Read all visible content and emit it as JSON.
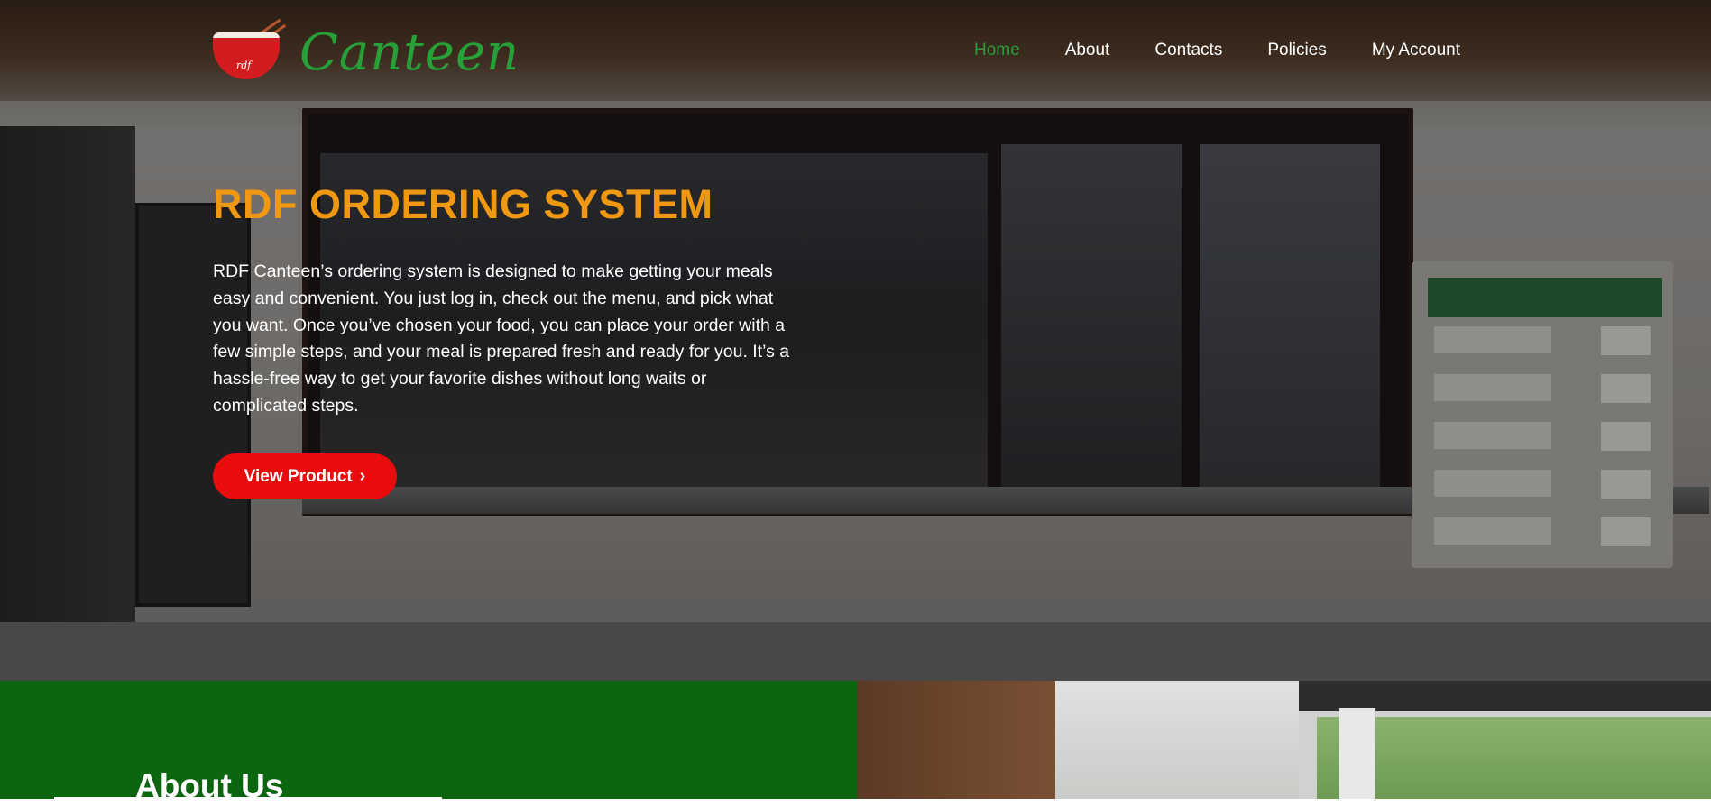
{
  "brand": {
    "name": "Canteen",
    "mark": "rdf"
  },
  "nav": {
    "items": [
      {
        "label": "Home",
        "active": true
      },
      {
        "label": "About",
        "active": false
      },
      {
        "label": "Contacts",
        "active": false
      },
      {
        "label": "Policies",
        "active": false
      },
      {
        "label": "My Account",
        "active": false
      }
    ]
  },
  "hero": {
    "title": "RDF ORDERING SYSTEM",
    "description": "RDF Canteen’s ordering system is designed to make getting your meals easy and convenient. You just log in, check out the menu, and pick what you want. Once you’ve chosen your food, you can place your order with a few simple steps, and your meal is prepared fresh and ready for you. It’s a hassle-free way to get your favorite dishes without long waits or complicated steps.",
    "cta_label": "View Product",
    "cta_icon": "chevron-right-icon"
  },
  "about": {
    "title": "About Us"
  },
  "colors": {
    "accent_orange": "#f09812",
    "brand_green": "#27a137",
    "section_green": "#0c650f",
    "cta_red": "#e80c0c",
    "nav_active": "#2a9c3b"
  }
}
